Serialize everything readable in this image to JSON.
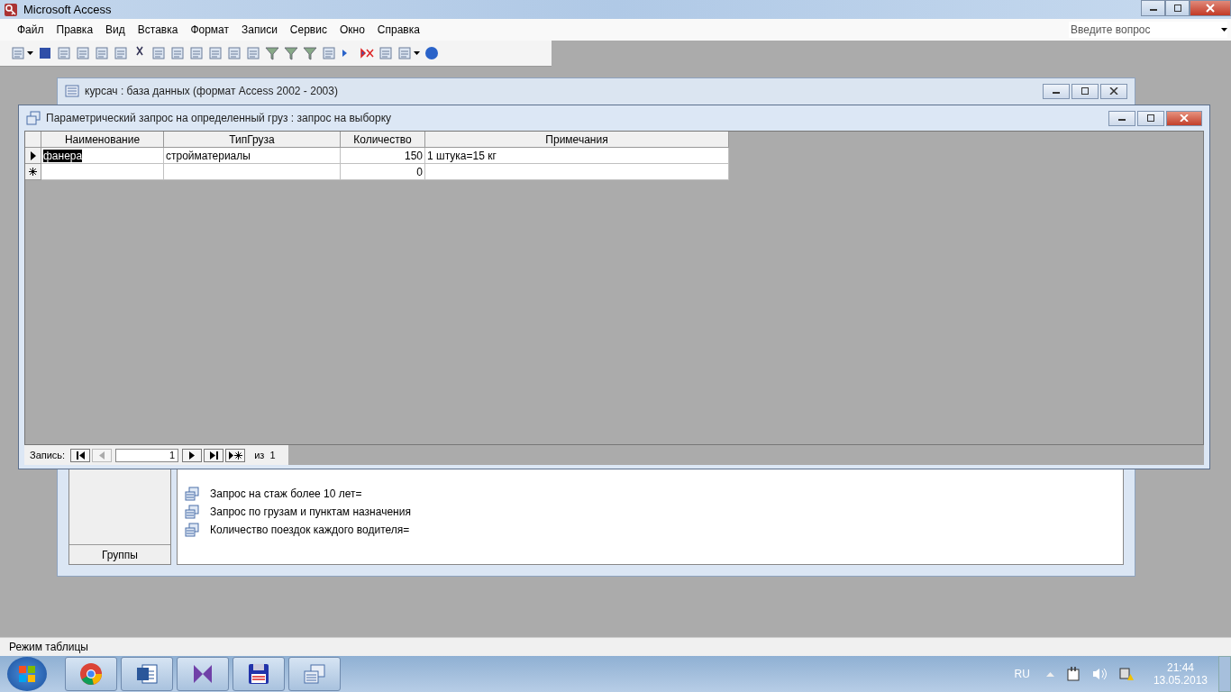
{
  "app": {
    "title": "Microsoft Access"
  },
  "menu": [
    {
      "label": "Файл"
    },
    {
      "label": "Правка"
    },
    {
      "label": "Вид"
    },
    {
      "label": "Вставка"
    },
    {
      "label": "Формат"
    },
    {
      "label": "Записи"
    },
    {
      "label": "Сервис"
    },
    {
      "label": "Окно"
    },
    {
      "label": "Справка"
    }
  ],
  "help_box": {
    "placeholder": "Введите вопрос"
  },
  "db_window": {
    "title": "курсач : база данных (формат Access 2002 - 2003)",
    "groups_button": "Группы",
    "objects": [
      "Запрос на стаж более 10 лет=",
      "Запрос по грузам и пунктам назначения",
      "Количество поездок каждого водителя="
    ]
  },
  "query_window": {
    "title": "Параметрический запрос на определенный груз : запрос на выборку",
    "columns": [
      "Наименование",
      "ТипГруза",
      "Количество",
      "Примечания"
    ],
    "rows": [
      {
        "cells": [
          "фанера",
          "стройматериалы",
          "150",
          "1 штука=15 кг"
        ],
        "selected": true
      }
    ],
    "new_row": {
      "quantity": "0"
    },
    "navigator": {
      "label": "Запись:",
      "current": "1",
      "of": "из",
      "total": "1"
    }
  },
  "status_bar": "Режим таблицы",
  "tray": {
    "language": "RU",
    "time": "21:44",
    "date": "13.05.2013"
  }
}
